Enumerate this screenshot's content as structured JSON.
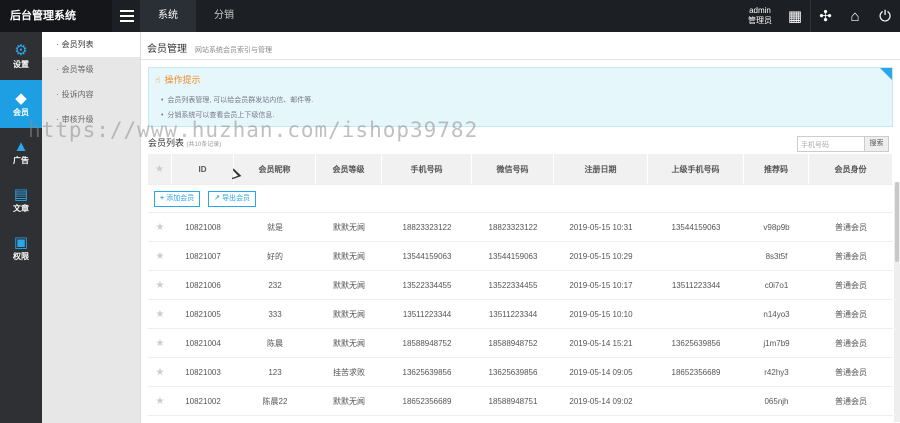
{
  "app": {
    "title": "后台管理系统"
  },
  "topnav": {
    "tabs": [
      "系统",
      "分销"
    ]
  },
  "user": {
    "name": "admin",
    "role": "管理员"
  },
  "iconbar": [
    {
      "label": "设置",
      "icon": "gear-icon",
      "glyph": "⚙"
    },
    {
      "label": "会员",
      "icon": "diamond-icon",
      "glyph": "◆"
    },
    {
      "label": "广告",
      "icon": "megaphone-icon",
      "glyph": "▲"
    },
    {
      "label": "文章",
      "icon": "document-icon",
      "glyph": "▤"
    },
    {
      "label": "权限",
      "icon": "lock-icon",
      "glyph": "▣"
    }
  ],
  "submenu": [
    "会员列表",
    "会员等级",
    "投诉内容",
    "审核升级"
  ],
  "page": {
    "title": "会员管理",
    "subtitle": "网站系统会员索引与管理"
  },
  "tips": {
    "title": "操作提示",
    "lines": [
      "会员列表管理, 可以给会员群发站内信、邮件等.",
      "分销系统可以查看会员上下级信息."
    ]
  },
  "list": {
    "title": "会员列表",
    "subtitle": "(共10条记录)"
  },
  "search": {
    "placeholder": "手机号码",
    "button": "搜索"
  },
  "table": {
    "headers": [
      "ID",
      "会员昵称",
      "会员等级",
      "手机号码",
      "微信号码",
      "注册日期",
      "上级手机号码",
      "推荐码",
      "会员身份"
    ],
    "rows": [
      [
        "10821008",
        "就是",
        "默默无闻",
        "18823323122",
        "18823323122",
        "2019-05-15 10:31",
        "13544159063",
        "v98p9b",
        "普通会员"
      ],
      [
        "10821007",
        "好的",
        "默默无闻",
        "13544159063",
        "13544159063",
        "2019-05-15 10:29",
        "",
        "8s3t5f",
        "普通会员"
      ],
      [
        "10821006",
        "232",
        "默默无闻",
        "13522334455",
        "13522334455",
        "2019-05-15 10:17",
        "13511223344",
        "c0i7o1",
        "普通会员"
      ],
      [
        "10821005",
        "333",
        "默默无闻",
        "13511223344",
        "13511223344",
        "2019-05-15 10:10",
        "",
        "n14yo3",
        "普通会员"
      ],
      [
        "10821004",
        "陈晨",
        "默默无闻",
        "18588948752",
        "18588948752",
        "2019-05-14 15:21",
        "13625639856",
        "j1m7b9",
        "普通会员"
      ],
      [
        "10821003",
        "123",
        "挂苦求败",
        "13625639856",
        "13625639856",
        "2019-05-14 09:05",
        "18652356689",
        "r42hy3",
        "普通会员"
      ],
      [
        "10821002",
        "陈晨22",
        "默默无闻",
        "18652356689",
        "18588948751",
        "2019-05-14 09:02",
        "",
        "065njh",
        "普通会员"
      ]
    ]
  },
  "actions": {
    "add": "添加会员",
    "export": "导出会员"
  },
  "watermark": "https://www.huzhan.com/ishop39782"
}
